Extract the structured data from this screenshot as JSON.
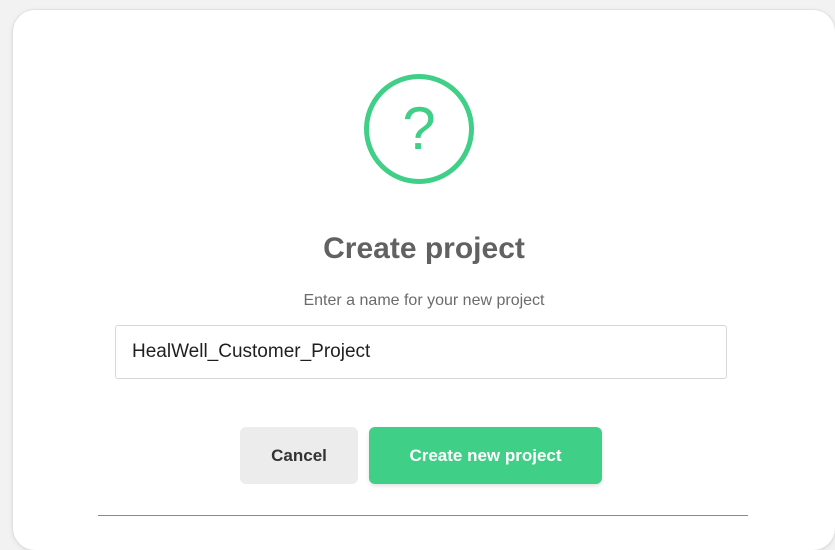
{
  "dialog": {
    "icon": "question-mark-icon",
    "icon_glyph": "?",
    "title": "Create project",
    "subtitle": "Enter a name for your new project",
    "project_name_value": "HealWell_Customer_Project",
    "cancel_label": "Cancel",
    "create_label": "Create new project"
  },
  "colors": {
    "accent": "#3fcf86",
    "cancel_bg": "#ececec",
    "title_text": "#616161"
  }
}
